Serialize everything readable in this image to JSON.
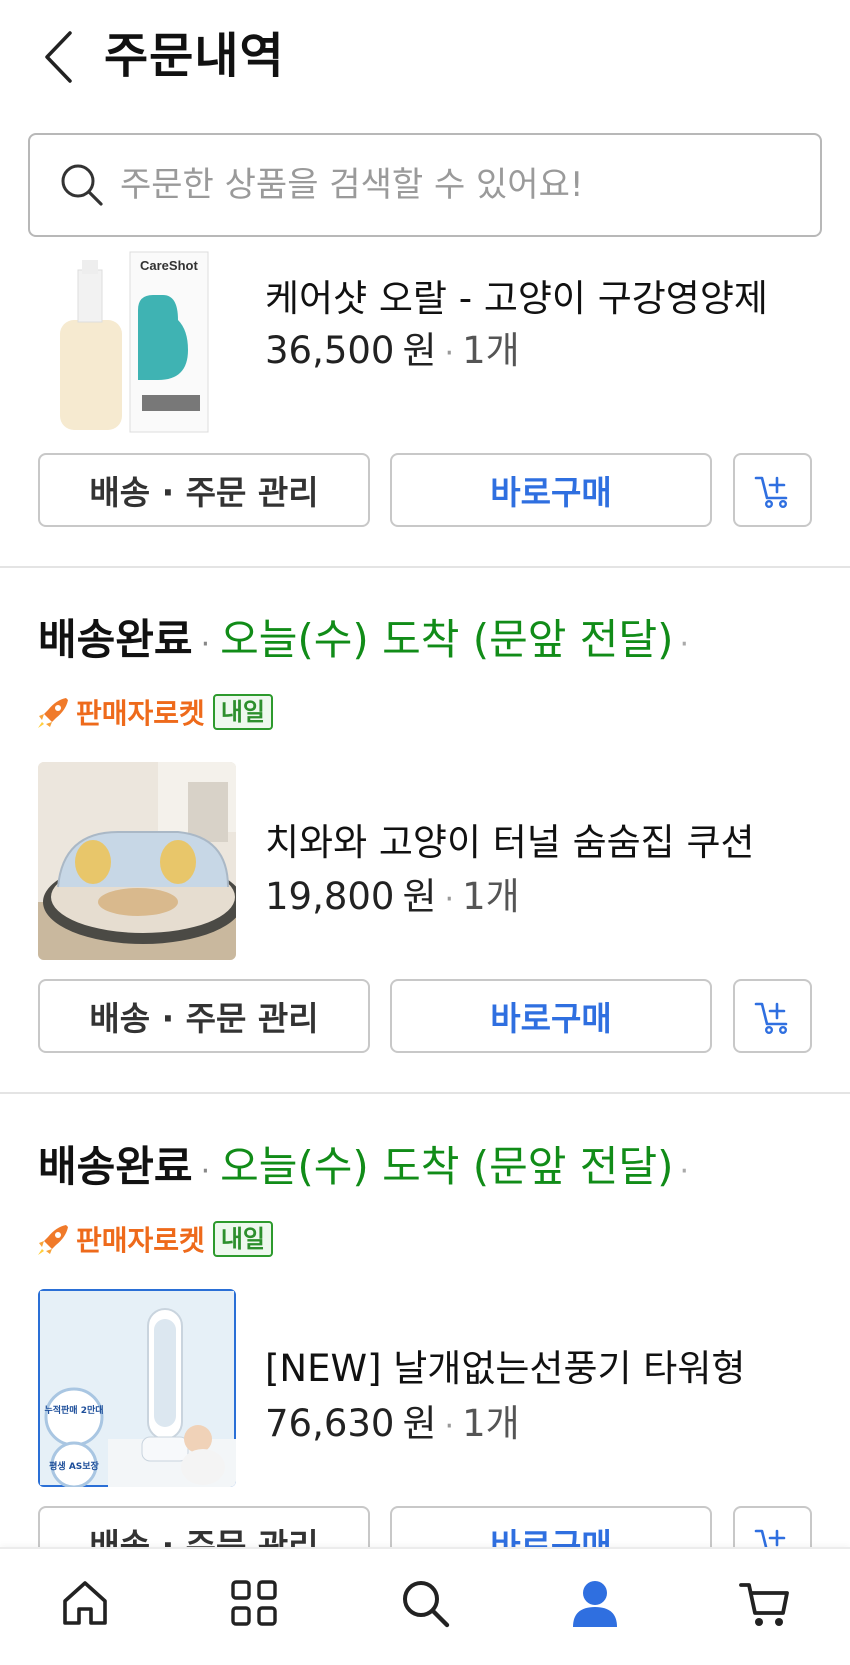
{
  "header": {
    "title": "주문내역",
    "back_icon": "chevron-left-icon"
  },
  "search": {
    "placeholder": "주문한 상품을 검색할 수 있어요!",
    "value": "",
    "icon": "search-icon"
  },
  "orders": [
    {
      "status": "",
      "arrival": "",
      "seller_badge": "",
      "delivery_tag": "",
      "product": {
        "name": "케어샷 오랄 - 고양이 구강영양제",
        "price": "36,500",
        "currency": "원",
        "quantity": "1개",
        "image_text": "CareShot"
      },
      "buttons": {
        "manage": "배송 · 주문 관리",
        "buy": "바로구매",
        "cart_icon": "add-to-cart-icon"
      }
    },
    {
      "status": "배송완료",
      "arrival": "오늘(수) 도착 (문앞 전달)",
      "seller_badge": "판매자로켓",
      "delivery_tag": "내일",
      "product": {
        "name": "치와와 고양이 터널 숨숨집 쿠션",
        "price": "19,800",
        "currency": "원",
        "quantity": "1개"
      },
      "buttons": {
        "manage": "배송 · 주문 관리",
        "buy": "바로구매",
        "cart_icon": "add-to-cart-icon"
      }
    },
    {
      "status": "배송완료",
      "arrival": "오늘(수) 도착 (문앞 전달)",
      "seller_badge": "판매자로켓",
      "delivery_tag": "내일",
      "product": {
        "name": "[NEW] 날개없는선풍기 타워형",
        "price": "76,630",
        "currency": "원",
        "quantity": "1개",
        "image_badges": [
          "누적판매 2만대",
          "평생 AS보장"
        ]
      },
      "buttons": {
        "manage": "배송 · 주문 관리",
        "buy": "바로구매",
        "cart_icon": "add-to-cart-icon"
      }
    }
  ],
  "bottom_nav": [
    {
      "icon": "home-icon",
      "active": false
    },
    {
      "icon": "category-grid-icon",
      "active": false
    },
    {
      "icon": "search-icon",
      "active": false
    },
    {
      "icon": "user-icon",
      "active": true
    },
    {
      "icon": "cart-icon",
      "active": false
    }
  ],
  "colors": {
    "accent_blue": "#2f6fe0",
    "arrival_green": "#118c18",
    "badge_orange": "#ee6a1b",
    "tag_green": "#2d8f2d"
  }
}
